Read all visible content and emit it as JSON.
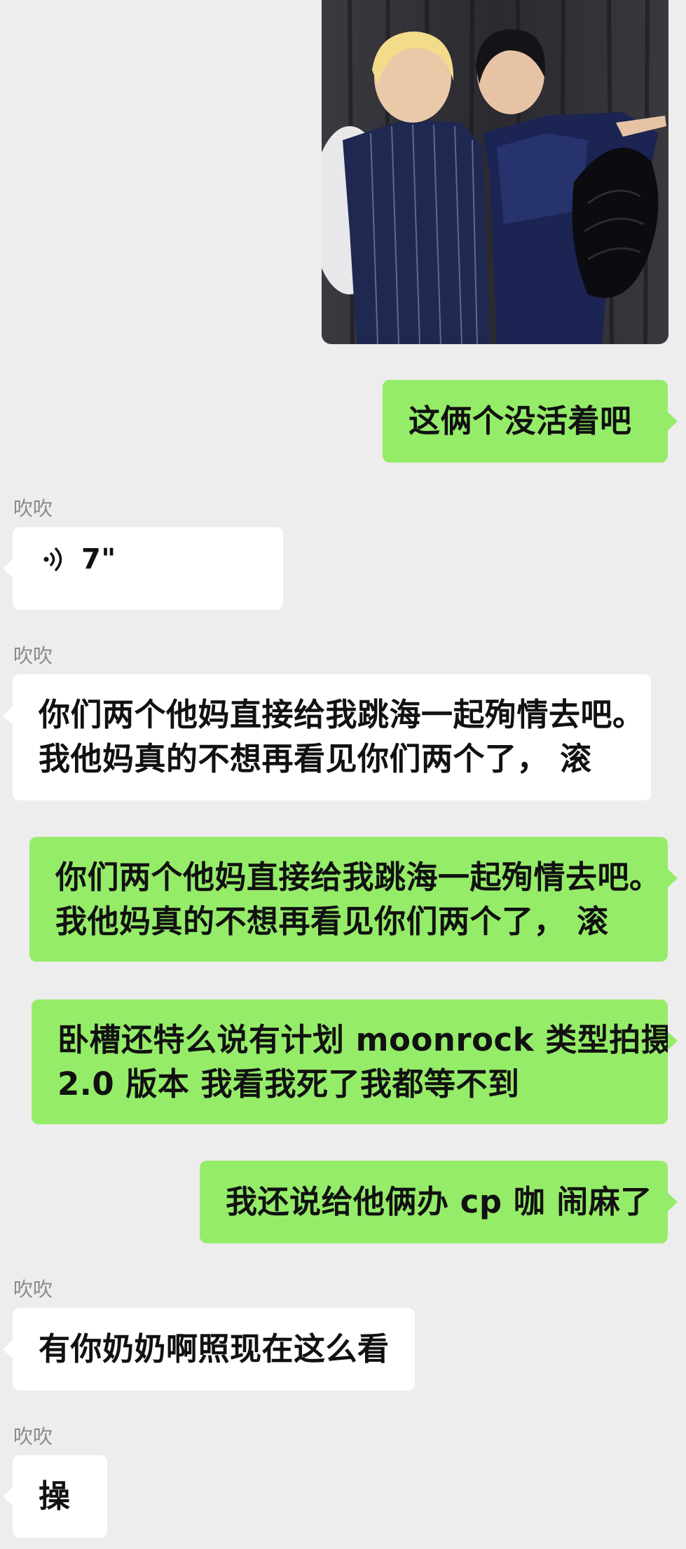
{
  "chat": {
    "image_alt": "photo-message",
    "messages": [
      {
        "id": "m1",
        "side": "me",
        "text": "这俩个没活着吧"
      },
      {
        "id": "m2",
        "side": "them",
        "sender": "吹吹",
        "type": "voice",
        "duration": "7\""
      },
      {
        "id": "m3",
        "side": "them",
        "sender": "吹吹",
        "lines": [
          "你们两个他妈直接给我跳海一起殉情去吧。",
          "我他妈真的不想再看见你们两个了，  滚"
        ]
      },
      {
        "id": "m4",
        "side": "me",
        "lines": [
          "你们两个他妈直接给我跳海一起殉情去吧。",
          "我他妈真的不想再看见你们两个了，  滚"
        ]
      },
      {
        "id": "m5",
        "side": "me",
        "lines": [
          "卧槽还特么说有计划 moonrock 类型拍摄",
          "2.0 版本 我看我死了我都等不到"
        ]
      },
      {
        "id": "m6",
        "side": "me",
        "text": "我还说给他俩办 cp 咖 闹麻了"
      },
      {
        "id": "m7",
        "side": "them",
        "sender": "吹吹",
        "text": "有你奶奶啊照现在这么看"
      },
      {
        "id": "m8",
        "side": "them",
        "sender": "吹吹",
        "text": "操"
      }
    ]
  },
  "colors": {
    "background": "#ededed",
    "me_bubble": "#95ec69",
    "them_bubble": "#ffffff",
    "sender_name": "#8a8a8a"
  },
  "icons": {
    "voice": "voice-wave-icon"
  }
}
